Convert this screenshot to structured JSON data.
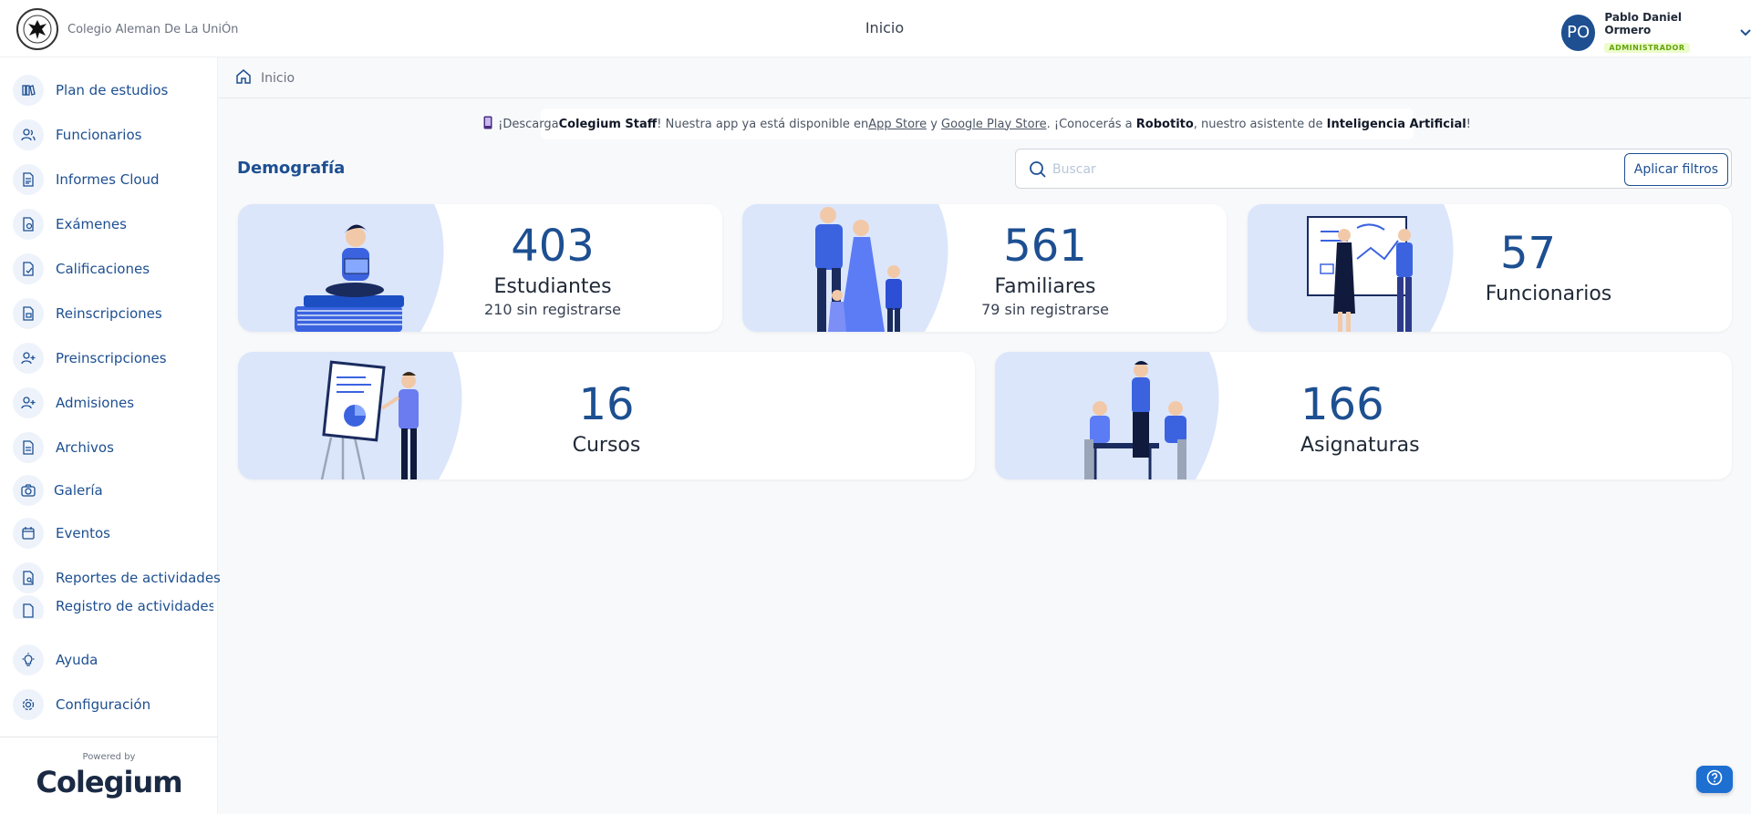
{
  "header": {
    "school_name": "Colegio Aleman De La UniÓn",
    "title": "Inicio",
    "user": {
      "initials": "PO",
      "name": "Pablo Daniel Ormero",
      "role": "ADMINISTRADOR"
    }
  },
  "sidebar": {
    "items": [
      {
        "label": "Plan de estudios",
        "icon": "books-icon"
      },
      {
        "label": "Funcionarios",
        "icon": "users-icon"
      },
      {
        "label": "Informes Cloud",
        "icon": "document-icon"
      },
      {
        "label": "Exámenes",
        "icon": "exam-icon"
      },
      {
        "label": "Calificaciones",
        "icon": "grades-icon"
      },
      {
        "label": "Reinscripciones",
        "icon": "reenroll-icon"
      },
      {
        "label": "Preinscripciones",
        "icon": "user-add-icon"
      },
      {
        "label": "Admisiones",
        "icon": "admission-icon"
      },
      {
        "label": "Archivos",
        "icon": "file-icon"
      },
      {
        "label": "Galería",
        "icon": "camera-icon"
      },
      {
        "label": "Eventos",
        "icon": "calendar-icon"
      },
      {
        "label": "Reportes de actividades",
        "icon": "report-icon"
      },
      {
        "label": "Registro de actividades",
        "icon": "log-icon"
      },
      {
        "label": "Ayuda",
        "icon": "lightbulb-icon"
      },
      {
        "label": "Configuración",
        "icon": "gear-icon"
      }
    ],
    "powered_by": "Powered by",
    "brand": "Colegium"
  },
  "breadcrumb": {
    "label": "Inicio"
  },
  "announcement": {
    "t1": "¡Descarga ",
    "b1": "Colegium Staff",
    "t2": "! Nuestra app ya está disponible en ",
    "l1": "App Store",
    "t3": " y ",
    "l2": "Google Play Store",
    "t4": ". ¡Conocerás a ",
    "b2": "Robotito",
    "t5": ", nuestro asistente de ",
    "b3": "Inteligencia Artificial",
    "t6": "!"
  },
  "section": {
    "title": "Demografía"
  },
  "search": {
    "placeholder": "Buscar",
    "button": "Aplicar filtros"
  },
  "stats": {
    "students": {
      "value": "403",
      "label": "Estudiantes",
      "sub": "210 sin registrarse"
    },
    "families": {
      "value": "561",
      "label": "Familiares",
      "sub": "79 sin registrarse"
    },
    "staff": {
      "value": "57",
      "label": "Funcionarios"
    },
    "courses": {
      "value": "16",
      "label": "Cursos"
    },
    "subjects": {
      "value": "166",
      "label": "Asignaturas"
    }
  },
  "colors": {
    "primary": "#1d4f91",
    "accent": "#4f6ef7",
    "illus_bg": "#dbe6fb",
    "role_badge": "#65a30d"
  }
}
